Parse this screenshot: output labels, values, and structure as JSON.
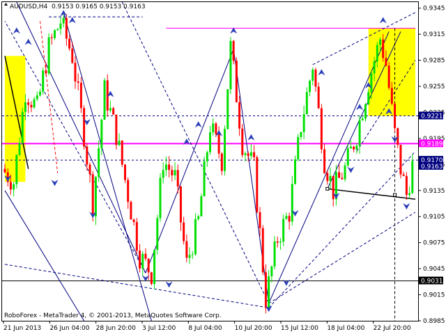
{
  "header": {
    "symbol": "AUDUSD,H4",
    "ohlc": "0.9153 0.9165 0.9153 0.9163"
  },
  "footer": {
    "copyright": "RoboForex - MetaTrader 4, © 2001-2013, MetaQuotes Software Corp."
  },
  "colors": {
    "background": "#ffffff",
    "bull": "#00e000",
    "bear": "#ff0000",
    "pink_line": "#ff00ff",
    "zone": "#ffff00",
    "trend": "#000080",
    "marker": "#2a3eb8",
    "price_box": "#000080"
  },
  "icons": {
    "fractal_marker": "triangle-arrow-icon"
  },
  "chart_data": {
    "type": "candlestick",
    "ylim": [
      0.8985,
      0.9352
    ],
    "y_ticks": [
      "0.9345",
      "0.9315",
      "0.9285",
      "0.9255",
      "0.9225",
      "0.9195",
      "0.9165",
      "0.9135",
      "0.9105",
      "0.9075",
      "0.9045",
      "0.9015",
      "0.8985"
    ],
    "x_ticks": [
      "21 Jun 2013",
      "26 Jun 04:00",
      "28 Jun 20:00",
      "3 Jul 12:00",
      "8 Jul 04:00",
      "10 Jul 20:00",
      "15 Jul 12:00",
      "18 Jul 04:00",
      "22 Jul 20:00"
    ],
    "bar_count": 140,
    "price_levels": [
      {
        "value": 0.9221,
        "label": "0.9221",
        "style": "dashed"
      },
      {
        "value": 0.9189,
        "label": "0.9189",
        "style": "pink"
      },
      {
        "value": 0.917,
        "label": "0.9170",
        "style": "dashed"
      },
      {
        "value": 0.9163,
        "label": "0.9163",
        "style": "current"
      },
      {
        "value": 0.9031,
        "label": "0.9031",
        "style": "solid"
      }
    ],
    "close_path": [
      [
        0,
        0.916
      ],
      [
        4,
        0.9145
      ],
      [
        8,
        0.925
      ],
      [
        12,
        0.923
      ],
      [
        16,
        0.93
      ],
      [
        20,
        0.933
      ],
      [
        24,
        0.929
      ],
      [
        28,
        0.92
      ],
      [
        31,
        0.912
      ],
      [
        35,
        0.925
      ],
      [
        39,
        0.92
      ],
      [
        43,
        0.913
      ],
      [
        47,
        0.906
      ],
      [
        51,
        0.904
      ],
      [
        55,
        0.917
      ],
      [
        59,
        0.915
      ],
      [
        63,
        0.905
      ],
      [
        67,
        0.91
      ],
      [
        71,
        0.921
      ],
      [
        75,
        0.917
      ],
      [
        78,
        0.93
      ],
      [
        82,
        0.919
      ],
      [
        86,
        0.916
      ],
      [
        90,
        0.901
      ],
      [
        94,
        0.908
      ],
      [
        98,
        0.911
      ],
      [
        102,
        0.921
      ],
      [
        106,
        0.928
      ],
      [
        110,
        0.917
      ],
      [
        113,
        0.9135
      ],
      [
        117,
        0.916
      ],
      [
        121,
        0.92
      ],
      [
        125,
        0.926
      ],
      [
        129,
        0.931
      ],
      [
        131,
        0.928
      ],
      [
        134,
        0.92
      ],
      [
        136,
        0.916
      ],
      [
        138,
        0.913
      ],
      [
        140,
        0.9163
      ]
    ],
    "fractals": [
      {
        "x": 4,
        "y": 0.9318,
        "dir": "up"
      },
      {
        "x": 8,
        "y": 0.9305,
        "dir": "up"
      },
      {
        "x": 20,
        "y": 0.9338,
        "dir": "up"
      },
      {
        "x": 23,
        "y": 0.933,
        "dir": "up"
      },
      {
        "x": 1,
        "y": 0.915,
        "dir": "down"
      },
      {
        "x": 17,
        "y": 0.9145,
        "dir": "down"
      },
      {
        "x": 28,
        "y": 0.9215,
        "dir": "down"
      },
      {
        "x": 36,
        "y": 0.9245,
        "dir": "up"
      },
      {
        "x": 30,
        "y": 0.9108,
        "dir": "down"
      },
      {
        "x": 48,
        "y": 0.9035,
        "dir": "down"
      },
      {
        "x": 56,
        "y": 0.9028,
        "dir": "down"
      },
      {
        "x": 62,
        "y": 0.919,
        "dir": "up"
      },
      {
        "x": 66,
        "y": 0.921,
        "dir": "up"
      },
      {
        "x": 73,
        "y": 0.92,
        "dir": "up"
      },
      {
        "x": 78,
        "y": 0.9318,
        "dir": "up"
      },
      {
        "x": 84,
        "y": 0.9195,
        "dir": "up"
      },
      {
        "x": 90,
        "y": 0.9,
        "dir": "down"
      },
      {
        "x": 96,
        "y": 0.903,
        "dir": "down"
      },
      {
        "x": 99,
        "y": 0.911,
        "dir": "down"
      },
      {
        "x": 108,
        "y": 0.927,
        "dir": "up"
      },
      {
        "x": 113,
        "y": 0.913,
        "dir": "down"
      },
      {
        "x": 118,
        "y": 0.916,
        "dir": "down"
      },
      {
        "x": 121,
        "y": 0.923,
        "dir": "up"
      },
      {
        "x": 124,
        "y": 0.9255,
        "dir": "up"
      },
      {
        "x": 129,
        "y": 0.933,
        "dir": "up"
      },
      {
        "x": 131,
        "y": 0.9225,
        "dir": "up"
      },
      {
        "x": 133,
        "y": 0.9195,
        "dir": "down"
      },
      {
        "x": 137,
        "y": 0.9118,
        "dir": "down"
      }
    ],
    "zones": [
      {
        "x1": 0,
        "x2": 7,
        "y1": 0.9145,
        "y2": 0.929
      },
      {
        "x1": 124,
        "x2": 140,
        "y1": 0.9221,
        "y2": 0.9322
      }
    ],
    "lines": [
      {
        "pts": [
          [
            4,
            0.9352
          ],
          [
            48,
            0.904
          ]
        ],
        "style": "solid",
        "color": "trend"
      },
      {
        "pts": [
          [
            20,
            0.934
          ],
          [
            50,
            0.8985
          ]
        ],
        "style": "solid",
        "color": "trend"
      },
      {
        "pts": [
          [
            0,
            0.9135
          ],
          [
            27,
            0.8985
          ]
        ],
        "style": "solid",
        "color": "trend"
      },
      {
        "pts": [
          [
            48,
            0.904
          ],
          [
            78,
            0.9298
          ]
        ],
        "style": "solid",
        "color": "trend"
      },
      {
        "pts": [
          [
            78,
            0.9298
          ],
          [
            90,
            0.9005
          ]
        ],
        "style": "solid",
        "color": "trend"
      },
      {
        "pts": [
          [
            90,
            0.9005
          ],
          [
            131,
            0.9318
          ]
        ],
        "style": "solid",
        "color": "trend"
      },
      {
        "pts": [
          [
            110,
            0.9137
          ],
          [
            135,
            0.9318
          ]
        ],
        "style": "solid",
        "color": "trend"
      },
      {
        "pts": [
          [
            110,
            0.9137
          ],
          [
            140,
            0.9125
          ]
        ],
        "style": "solid",
        "color": "black"
      },
      {
        "pts": [
          [
            0,
            0.929
          ],
          [
            8,
            0.916
          ]
        ],
        "style": "solid",
        "color": "black"
      },
      {
        "pts": [
          [
            55,
            0.9322
          ],
          [
            140,
            0.9322
          ]
        ],
        "style": "solid",
        "color": "pink"
      },
      {
        "pts": [
          [
            15,
            0.9335
          ],
          [
            47,
            0.9335
          ]
        ],
        "style": "dashed",
        "color": "trend"
      },
      {
        "pts": [
          [
            105,
            0.928
          ],
          [
            140,
            0.934
          ]
        ],
        "style": "dashed",
        "color": "trend"
      },
      {
        "pts": [
          [
            0,
            0.905
          ],
          [
            90,
            0.9
          ]
        ],
        "style": "dashed",
        "color": "trend"
      },
      {
        "pts": [
          [
            90,
            0.9
          ],
          [
            140,
            0.918
          ]
        ],
        "style": "dashed",
        "color": "trend"
      },
      {
        "pts": [
          [
            48,
            0.904
          ],
          [
            0,
            0.933
          ]
        ],
        "style": "dashed",
        "color": "trend"
      },
      {
        "pts": [
          [
            40,
            0.9352
          ],
          [
            90,
            0.9005
          ]
        ],
        "style": "dashed",
        "color": "trend"
      },
      {
        "pts": [
          [
            90,
            0.9005
          ],
          [
            140,
            0.911
          ]
        ],
        "style": "dashed",
        "color": "trend"
      },
      {
        "pts": [
          [
            120,
            0.918
          ],
          [
            140,
            0.9285
          ]
        ],
        "style": "dashed",
        "color": "trend"
      },
      {
        "pts": [
          [
            133,
            0.9322
          ],
          [
            133,
            0.8985
          ]
        ],
        "style": "dashed",
        "color": "black"
      },
      {
        "pts": [
          [
            12,
            0.933
          ],
          [
            18,
            0.9155
          ]
        ],
        "style": "dashed",
        "color": "red"
      }
    ]
  }
}
